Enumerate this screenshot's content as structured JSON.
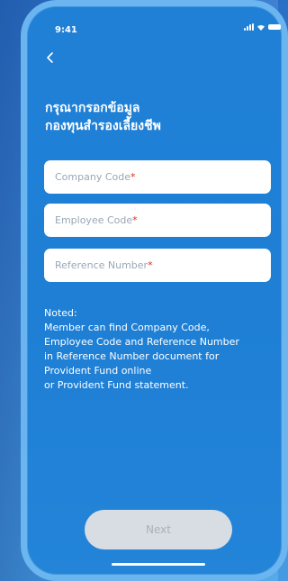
{
  "status_bar": {
    "time": "9:41"
  },
  "header": {
    "title_line1": "กรุณากรอกข้อมูล",
    "title_line2": "กองทุนสำรองเลี้ยงชีพ"
  },
  "form": {
    "company_code": {
      "placeholder": "Company Code",
      "required_mark": "*"
    },
    "employee_code": {
      "placeholder": "Employee Code",
      "required_mark": "*"
    },
    "reference_number": {
      "placeholder": "Reference Number",
      "required_mark": "*"
    }
  },
  "note": {
    "heading": "Noted:",
    "line1": "Member can find Company Code,",
    "line2": "Employee Code and Reference Number",
    "line3": "in Reference Number document for",
    "line4": "Provident Fund online",
    "line5": "or Provident Fund statement."
  },
  "actions": {
    "next_label": "Next",
    "next_enabled": false
  },
  "colors": {
    "accent": "#1e7fd5",
    "required": "#d92d20",
    "button_disabled_bg": "#d8dde3",
    "button_disabled_text": "#a8b0ba"
  },
  "icons": {
    "back": "chevron-left-icon",
    "signal": "signal-icon",
    "wifi": "wifi-icon",
    "battery": "battery-icon"
  }
}
